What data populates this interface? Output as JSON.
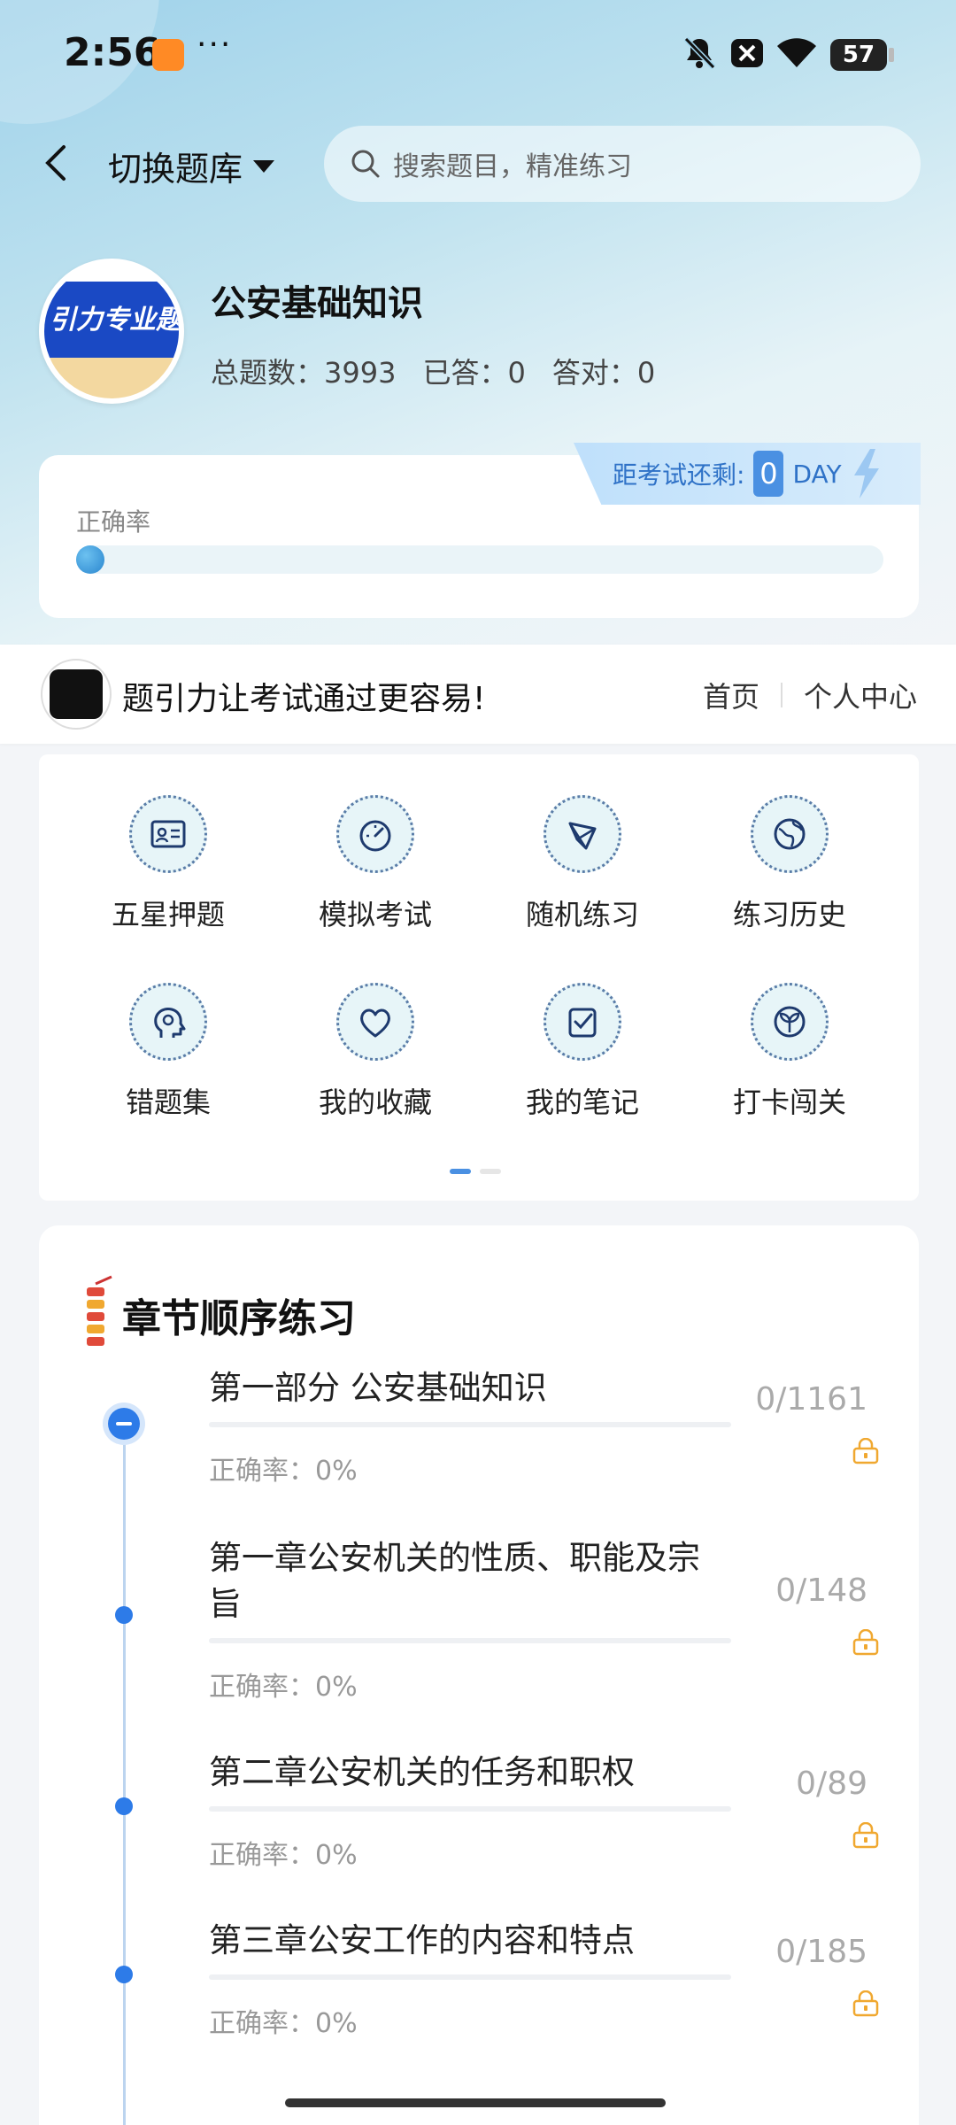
{
  "status_bar": {
    "time": "2:56",
    "dots": "···",
    "battery": "57"
  },
  "header": {
    "switch_label": "切换题库",
    "search_placeholder": "搜索题目，精准练习"
  },
  "bank": {
    "logo_text": "引力专业题",
    "title": "公安基础知识",
    "total_label": "总题数：3993",
    "answered_label": "已答：0",
    "correct_label": "答对：0"
  },
  "accuracy": {
    "label": "正确率",
    "value_percent": 0,
    "exam_prefix": "距考试还剩:",
    "exam_days": "0",
    "exam_unit": "DAY"
  },
  "slogan_bar": {
    "slogan": "题引力让考试通过更容易!",
    "home_link": "首页",
    "personal_link": "个人中心"
  },
  "grid": [
    {
      "label": "五星押题",
      "icon": "id-card-icon"
    },
    {
      "label": "模拟考试",
      "icon": "gauge-icon"
    },
    {
      "label": "随机练习",
      "icon": "network-icon"
    },
    {
      "label": "练习历史",
      "icon": "globe-icon"
    },
    {
      "label": "错题集",
      "icon": "head-icon"
    },
    {
      "label": "我的收藏",
      "icon": "heart-icon"
    },
    {
      "label": "我的笔记",
      "icon": "note-check-icon"
    },
    {
      "label": "打卡闯关",
      "icon": "sprout-icon"
    }
  ],
  "chapters": {
    "title": "章节顺序练习",
    "items": [
      {
        "name": "第一部分 公安基础知识",
        "rate": "正确率：0%",
        "count": "0/1161"
      },
      {
        "name": "第一章公安机关的性质、职能及宗旨",
        "rate": "正确率：0%",
        "count": "0/148"
      },
      {
        "name": "第二章公安机关的任务和职权",
        "rate": "正确率：0%",
        "count": "0/89"
      },
      {
        "name": "第三章公安工作的内容和特点",
        "rate": "正确率：0%",
        "count": "0/185"
      }
    ]
  },
  "colors": {
    "accent": "#2d7be8",
    "lock": "#f0a830"
  }
}
